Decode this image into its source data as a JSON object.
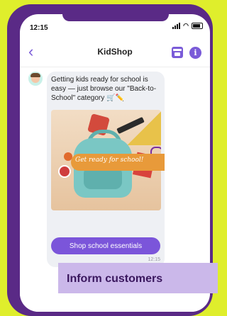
{
  "status_bar": {
    "time": "12:15"
  },
  "header": {
    "title": "KidShop"
  },
  "message": {
    "text": "Getting kids ready for school is easy — just browse our \"Back-to-School\" category 🛒✏️",
    "image_caption": "Get ready for school!",
    "cta_label": "Shop school essentials",
    "timestamp": "12:15"
  },
  "banner": {
    "text": "Inform customers"
  },
  "colors": {
    "background": "#dfee2c",
    "phone_frame": "#5a2a86",
    "accent": "#7b55da",
    "banner": "#cbb8ea",
    "banner_text": "#3a175e"
  },
  "icons": [
    "back-chevron-icon",
    "store-icon",
    "info-icon",
    "signal-icon",
    "wifi-icon",
    "battery-icon",
    "avatar"
  ]
}
